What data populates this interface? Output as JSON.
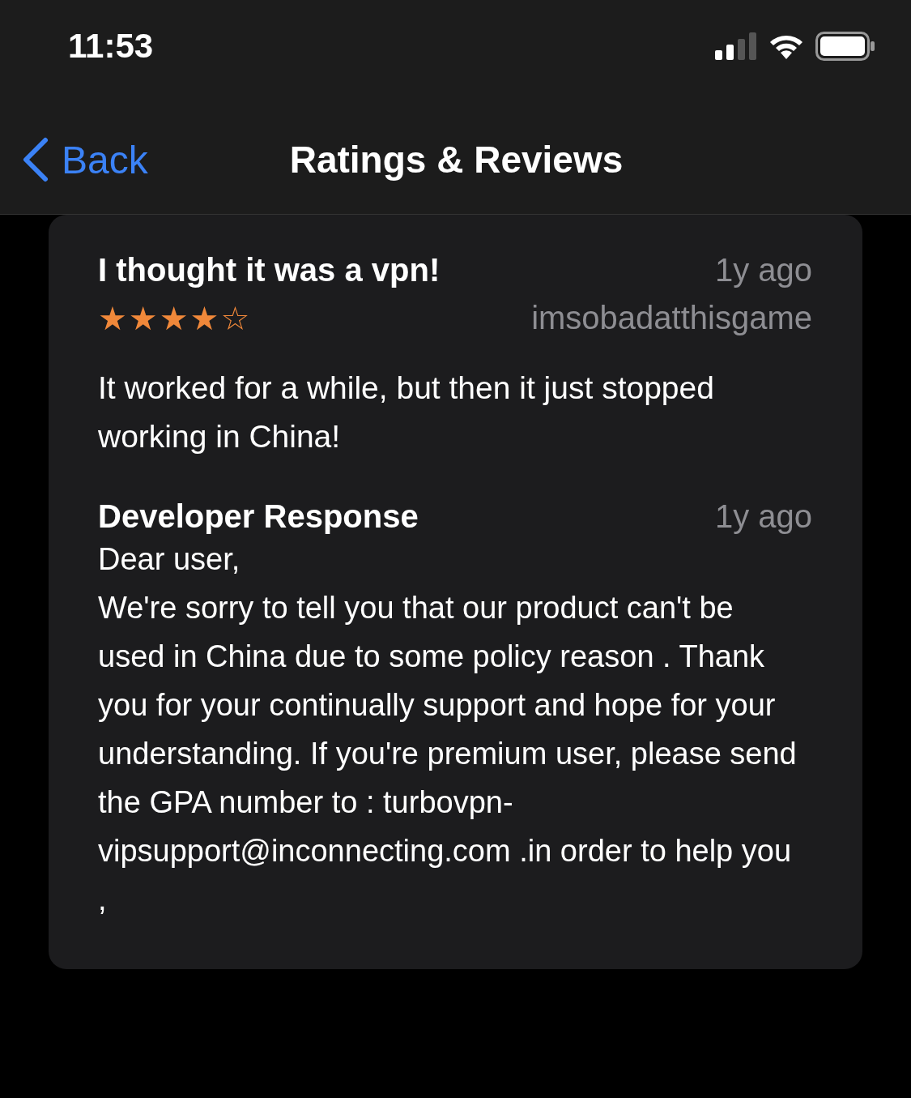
{
  "status_bar": {
    "time": "11:53"
  },
  "nav": {
    "back": "Back",
    "title": "Ratings & Reviews"
  },
  "review": {
    "title": "I thought it was a vpn!",
    "date": "1y ago",
    "stars": 4,
    "author": "imsobadatthisgame",
    "body": "It worked for a while, but then it just stopped working in China!",
    "response": {
      "title": "Developer Response",
      "date": "1y ago",
      "paragraphs": [
        "Dear user,",
        "We're sorry to tell you that our product can't be used in China due to some policy reason . Thank you for your continually support and hope for your understanding. If you're premium user, please send the GPA number to : turbovpn-vipsupport@inconnecting.com .in order to help you ,"
      ]
    }
  }
}
